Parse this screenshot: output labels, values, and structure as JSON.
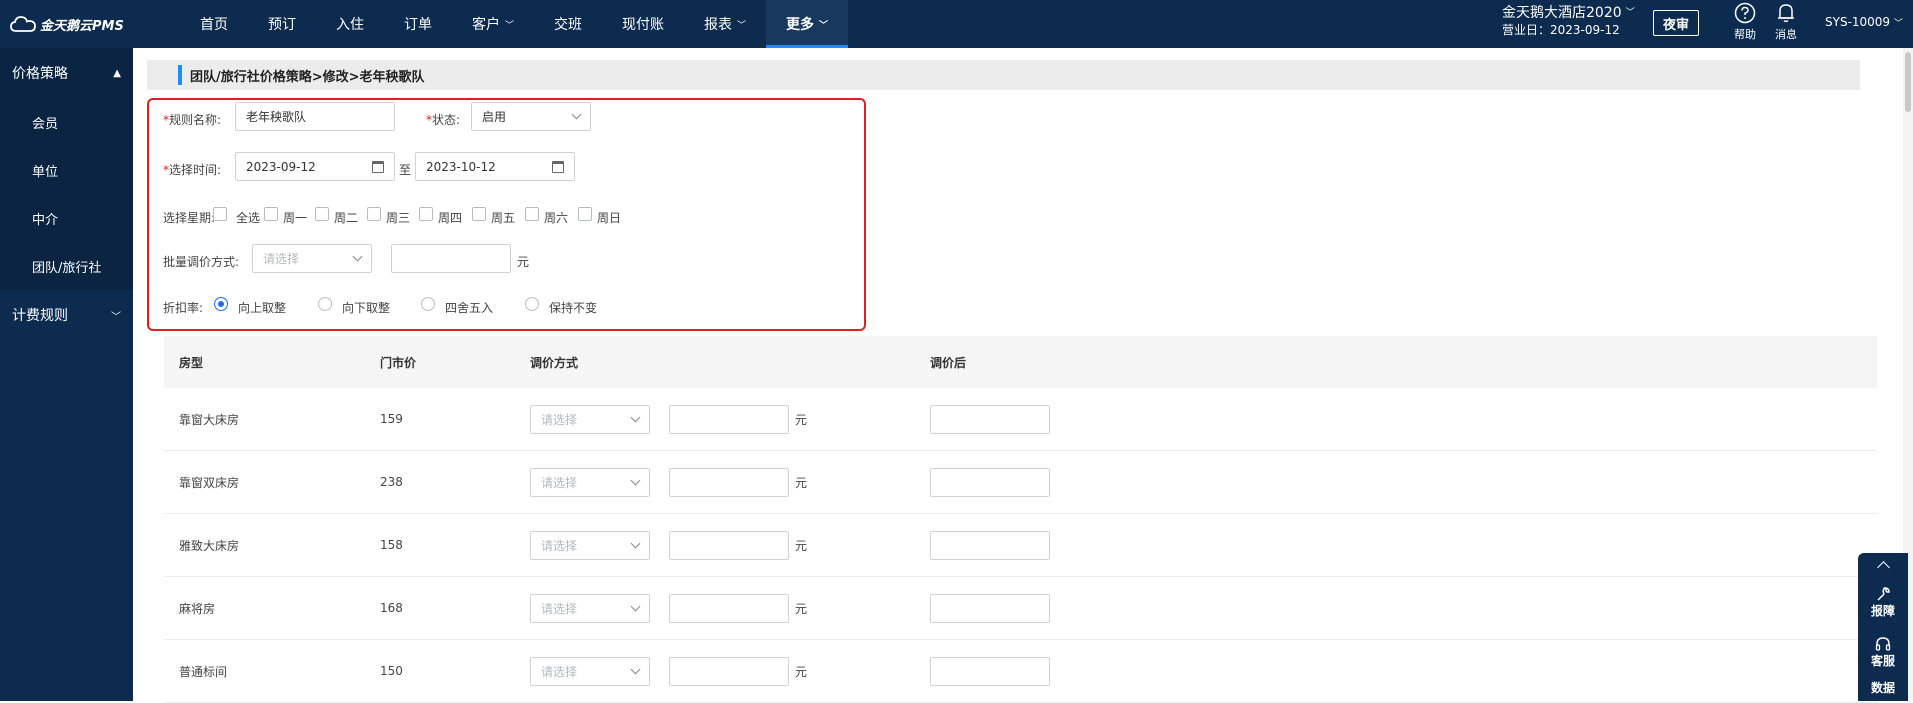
{
  "app": {
    "brand": "金天鹅云PMS"
  },
  "nav": {
    "items": [
      {
        "label": "首页",
        "caret": false,
        "active": false
      },
      {
        "label": "预订",
        "caret": false,
        "active": false
      },
      {
        "label": "入住",
        "caret": false,
        "active": false
      },
      {
        "label": "订单",
        "caret": false,
        "active": false
      },
      {
        "label": "客户",
        "caret": true,
        "active": false
      },
      {
        "label": "交班",
        "caret": false,
        "active": false
      },
      {
        "label": "现付账",
        "caret": false,
        "active": false
      },
      {
        "label": "报表",
        "caret": true,
        "active": false
      },
      {
        "label": "更多",
        "caret": true,
        "active": true
      }
    ]
  },
  "header": {
    "hotel_name": "金天鹅大酒店2020",
    "business_day": "营业日：2023-09-12",
    "night_audit_label": "夜审",
    "help_label": "帮助",
    "messages_label": "消息",
    "user": "SYS-10009"
  },
  "sidebar": {
    "group1": "价格策略",
    "items": [
      "会员",
      "单位",
      "中介",
      "团队/旅行社"
    ],
    "group2": "计费规则"
  },
  "breadcrumb": "团队/旅行社价格策略>修改>老年秧歌队",
  "form": {
    "rule_name_label": "规则名称:",
    "rule_name_value": "老年秧歌队",
    "status_label": "状态:",
    "status_value": "启用",
    "time_label": "选择时间:",
    "start_date": "2023-09-12",
    "to_label": "至",
    "end_date": "2023-10-12",
    "weekday_label": "选择星期:",
    "weekdays": [
      "全选",
      "周一",
      "周二",
      "周三",
      "周四",
      "周五",
      "周六",
      "周日"
    ],
    "batch_label": "批量调价方式:",
    "batch_placeholder": "请选择",
    "unit": "元",
    "discount_label": "折扣率:",
    "rounding_options": [
      "向上取整",
      "向下取整",
      "四舍五入",
      "保持不变"
    ],
    "rounding_selected": "向上取整"
  },
  "table": {
    "headers": [
      "房型",
      "门市价",
      "调价方式",
      "调价后"
    ],
    "select_placeholder": "请选择",
    "unit": "元",
    "rows": [
      {
        "room": "靠窗大床房",
        "price": "159"
      },
      {
        "room": "靠窗双床房",
        "price": "238"
      },
      {
        "room": "雅致大床房",
        "price": "158"
      },
      {
        "room": "麻将房",
        "price": "168"
      },
      {
        "room": "普通标间",
        "price": "150"
      }
    ]
  },
  "float_tools": {
    "items": [
      "报障",
      "客服",
      "数据"
    ]
  },
  "colors": {
    "nav_bg": "#0d2b4e",
    "accent": "#1e8cff",
    "required": "#e02020",
    "highlight_border": "#e02020"
  }
}
